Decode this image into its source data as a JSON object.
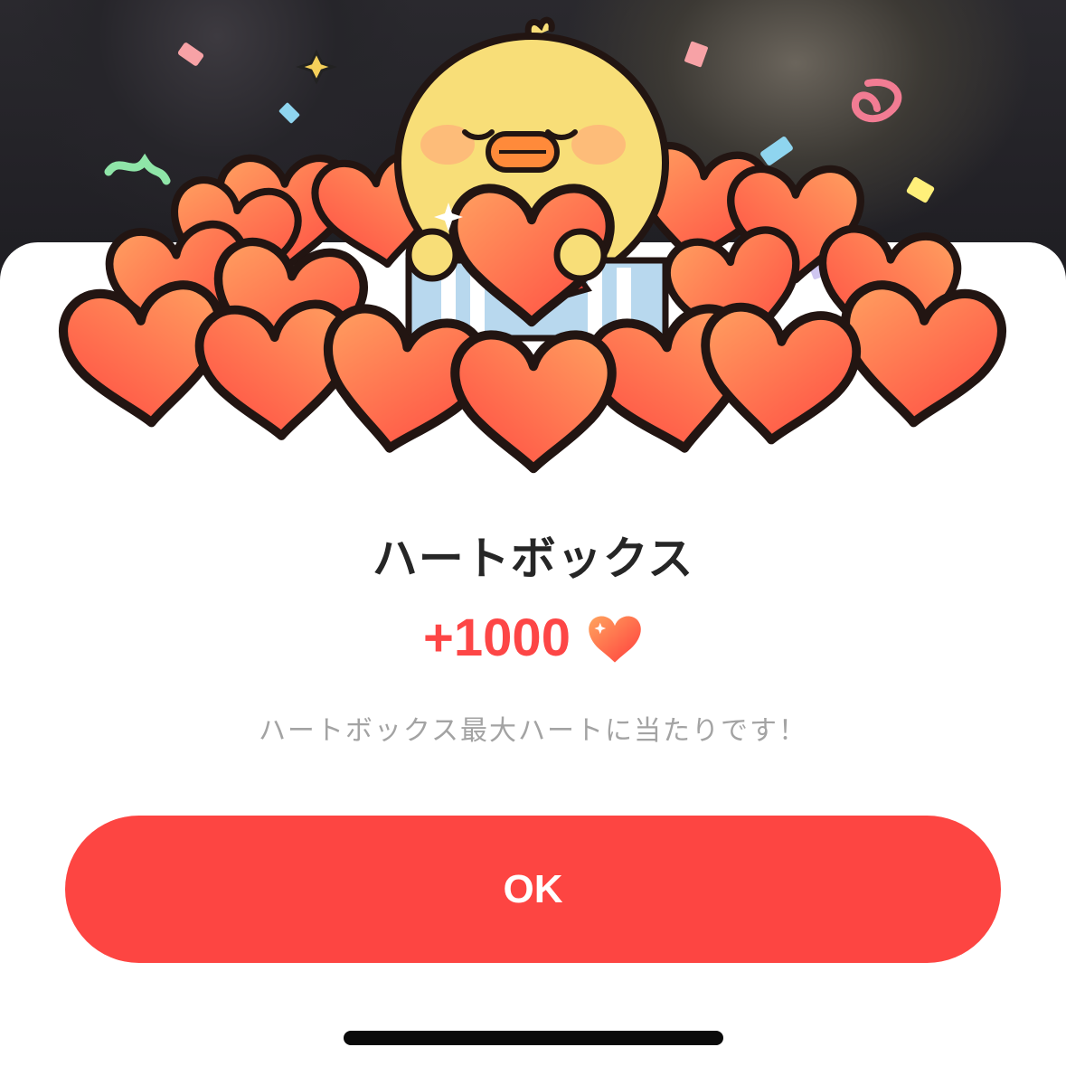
{
  "dialog": {
    "title": "ハートボックス",
    "reward_amount": "+1000",
    "reward_icon": "heart-icon",
    "message": "ハートボックス最大ハートに当たりです！",
    "ok_label": "OK"
  },
  "colors": {
    "accent": "#fd4542",
    "reward_text": "#fd4646",
    "title_text": "#262626",
    "message_text": "#a3a3a3",
    "heart_fill_top": "#ff9a5a",
    "heart_fill_bottom": "#ff4a42",
    "heart_outline": "#221512",
    "chick_fill": "#f8de78"
  },
  "illustration": {
    "character": "chick-icon",
    "decorations": [
      "confetti",
      "sparkle-icon",
      "gift-box-icon"
    ]
  }
}
